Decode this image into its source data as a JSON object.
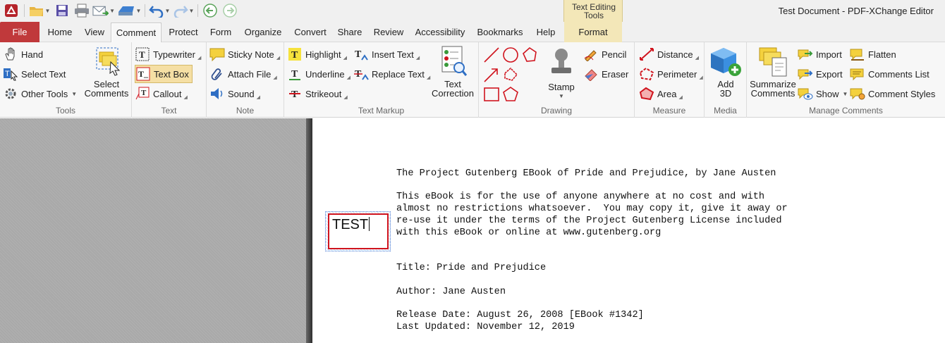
{
  "window": {
    "title": "Test Document - PDF-XChange Editor"
  },
  "context_group": {
    "title_line1": "Text Editing",
    "title_line2": "Tools"
  },
  "tabs": {
    "file": "File",
    "home": "Home",
    "view": "View",
    "comment": "Comment",
    "protect": "Protect",
    "form": "Form",
    "organize": "Organize",
    "convert": "Convert",
    "share": "Share",
    "review": "Review",
    "accessibility": "Accessibility",
    "bookmarks": "Bookmarks",
    "help": "Help",
    "format": "Format"
  },
  "ribbon": {
    "tools": {
      "label": "Tools",
      "hand": "Hand",
      "select_text": "Select Text",
      "other_tools": "Other Tools",
      "select_comments_1": "Select",
      "select_comments_2": "Comments"
    },
    "text": {
      "label": "Text",
      "typewriter": "Typewriter",
      "text_box": "Text Box",
      "callout": "Callout"
    },
    "note": {
      "label": "Note",
      "sticky_note": "Sticky Note",
      "attach_file": "Attach File",
      "sound": "Sound"
    },
    "text_markup": {
      "label": "Text Markup",
      "highlight": "Highlight",
      "underline": "Underline",
      "strikeout": "Strikeout",
      "insert_text": "Insert Text",
      "replace_text": "Replace Text",
      "text_correction_1": "Text",
      "text_correction_2": "Correction"
    },
    "drawing": {
      "label": "Drawing",
      "stamp": "Stamp",
      "pencil": "Pencil",
      "eraser": "Eraser"
    },
    "measure": {
      "label": "Measure",
      "distance": "Distance",
      "perimeter": "Perimeter",
      "area": "Area"
    },
    "media": {
      "label": "Media",
      "add3d_1": "Add",
      "add3d_2": "3D"
    },
    "manage": {
      "label": "Manage Comments",
      "summarize_1": "Summarize",
      "summarize_2": "Comments",
      "import": "Import",
      "export": "Export",
      "show": "Show",
      "flatten": "Flatten",
      "comments_list": "Comments List",
      "comment_styles": "Comment Styles"
    }
  },
  "colors": {
    "file_tab": "#c0393b",
    "context": "#f3e7b8",
    "shape_red": "#d0141e",
    "selected": "#f5dfa4"
  },
  "document": {
    "lines": [
      "The Project Gutenberg EBook of Pride and Prejudice, by Jane Austen",
      "This eBook is for the use of anyone anywhere at no cost and with",
      "almost no restrictions whatsoever.  You may copy it, give it away or",
      "re-use it under the terms of the Project Gutenberg License included",
      "with this eBook or online at www.gutenberg.org",
      "Title: Pride and Prejudice",
      "Author: Jane Austen",
      "Release Date: August 26, 2008 [EBook #1342]",
      "Last Updated: November 12, 2019"
    ],
    "textbox_value": "TEST"
  }
}
